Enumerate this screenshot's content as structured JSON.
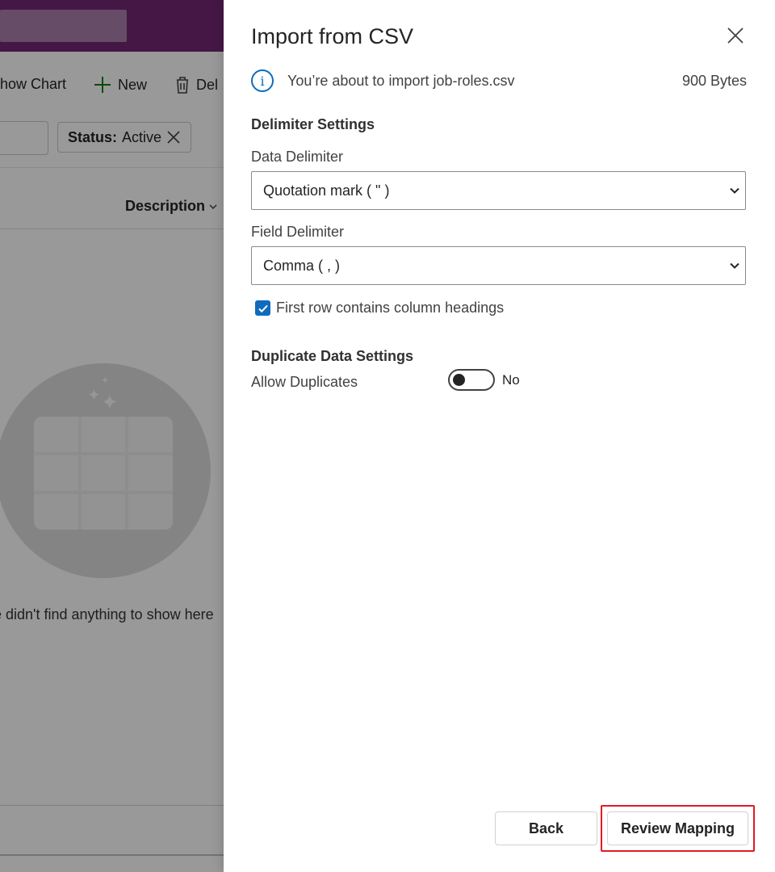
{
  "background": {
    "commands": {
      "show_chart": "how Chart",
      "new": "New",
      "delete": "Del"
    },
    "filter_chip": {
      "key": "Status:",
      "value": "Active"
    },
    "column_header": "Description",
    "empty_message": "e didn't find anything to show here"
  },
  "dialog": {
    "title": "Import from CSV",
    "info_text": "You’re about to import job-roles.csv",
    "file_size": "900 Bytes",
    "delimiter_settings": {
      "heading": "Delimiter Settings",
      "data_delimiter_label": "Data Delimiter",
      "data_delimiter_value": "Quotation mark ( \" )",
      "field_delimiter_label": "Field Delimiter",
      "field_delimiter_value": "Comma ( , )",
      "first_row_headings_label": "First row contains column headings"
    },
    "duplicate_settings": {
      "heading": "Duplicate Data Settings",
      "allow_duplicates_label": "Allow Duplicates",
      "toggle_state": "No"
    },
    "buttons": {
      "back": "Back",
      "review_mapping": "Review Mapping"
    }
  },
  "colors": {
    "brand_bar": "#742774",
    "accent": "#0f6cbd",
    "highlight": "#e01b24"
  }
}
